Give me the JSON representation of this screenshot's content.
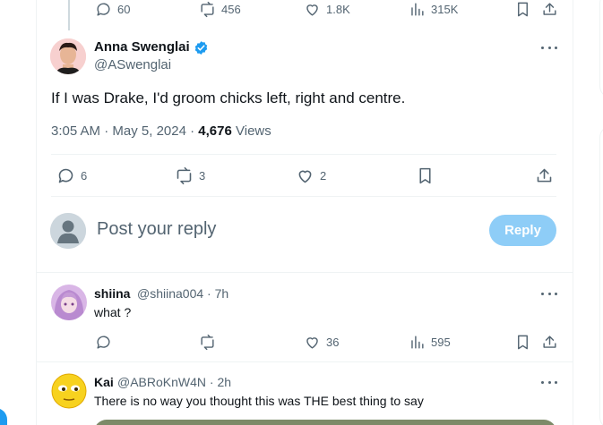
{
  "prev_tweet": {
    "replies": "60",
    "retweets": "456",
    "likes": "1.8K",
    "views": "315K"
  },
  "main_tweet": {
    "name": "Anna Swenglai",
    "handle": "@ASwenglai",
    "text": "If I was Drake, I'd groom chicks left, right and centre.",
    "time": "3:05 AM",
    "date": "May 5, 2024",
    "views_count": "4,676",
    "views_label": "Views",
    "replies": "6",
    "retweets": "3",
    "likes": "2"
  },
  "reply_box": {
    "placeholder": "Post your reply",
    "button": "Reply"
  },
  "replies": [
    {
      "name": "shiina",
      "handle": "@shiina004",
      "time": "7h",
      "text": "what ?",
      "likes": "36",
      "views": "595"
    },
    {
      "name": "Kai",
      "handle": "@ABRoKnW4N",
      "time": "2h",
      "text": "There is no way you thought this was THE best thing to say"
    }
  ],
  "colors": {
    "accent": "#1d9bf0",
    "reply_button_disabled": "#8ecdf7",
    "muted": "#536471"
  }
}
